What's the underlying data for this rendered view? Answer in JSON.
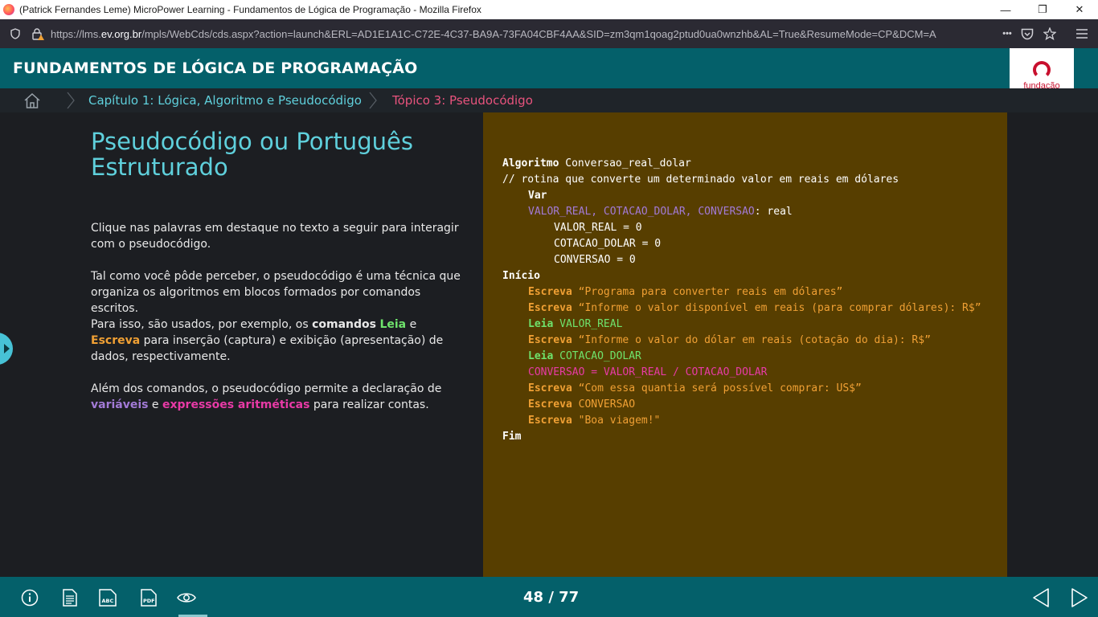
{
  "browser": {
    "window_title": "(Patrick Fernandes Leme) MicroPower Learning - Fundamentos de Lógica de Programação - Mozilla Firefox",
    "url_prefix": "https://lms.",
    "url_domain": "ev.org.br",
    "url_rest": "/mpls/WebCds/cds.aspx?action=launch&ERL=AD1E1A1C-C72E-4C37-BA9A-73FA04CBF4AA&SID=zm3qm1qoag2ptud0ua0wnzhb&AL=True&ResumeMode=CP&DCM=A",
    "more_label": "•••"
  },
  "course": {
    "title": "FUNDAMENTOS DE LÓGICA DE PROGRAMAÇÃO",
    "logo_line1": "fundação",
    "logo_line2": "bradesco"
  },
  "breadcrumb": {
    "chapter": "Capítulo 1: Lógica, Algoritmo e Pseudocódigo",
    "topic": "Tópico 3: Pseudocódigo"
  },
  "content": {
    "title": "Pseudocódigo ou Português Estruturado",
    "p1": "Clique nas palavras em destaque no texto a seguir para interagir com o pseudocódigo.",
    "p2": "Tal como você pôde perceber, o pseudocódigo é uma técnica que organiza os algoritmos em blocos formados por comandos escritos.",
    "p3_a": "Para isso, são usados, por exemplo, os ",
    "p3_comandos": "comandos",
    "p3_sp": " ",
    "p3_leia": "Leia",
    "p3_e": " e ",
    "p3_escreva": "Escreva",
    "p3_b": " para inserção (captura) e exibição (apresentação) de dados, respectivamente.",
    "p4_a": "Além dos comandos, o pseudocódigo permite a declaração de ",
    "p4_variaveis": "variáveis",
    "p4_e": " e ",
    "p4_expressoes": "expressões aritméticas",
    "p4_b": " para realizar contas."
  },
  "code": {
    "l1_kw": "Algoritmo",
    "l1_rest": " Conversao_real_dolar",
    "l2": "// rotina que converte um determinado valor em reais em dólares",
    "l3_kw": "Var",
    "l4_vars": "VALOR_REAL, COTACAO_DOLAR, CONVERSAO",
    "l4_rest": ": real",
    "l5": "VALOR_REAL = 0",
    "l6": "COTACAO_DOLAR = 0",
    "l7": "CONVERSAO = 0",
    "l8_kw": "Início",
    "l9_kw": "Escreva",
    "l9_rest": " “Programa para converter reais em dólares”",
    "l10_kw": "Escreva",
    "l10_rest": " “Informe o valor disponível em reais (para comprar dólares): R$”",
    "l11_kw": "Leia",
    "l11_rest": " VALOR_REAL",
    "l12_kw": "Escreva",
    "l12_rest": " “Informe o valor do dólar em reais (cotação do dia): R$”",
    "l13_kw": "Leia",
    "l13_rest": " COTACAO_DOLAR",
    "l14": "CONVERSAO = VALOR_REAL / COTACAO_DOLAR",
    "l15_kw": "Escreva",
    "l15_rest": " “Com essa quantia será possível comprar: US$”",
    "l16_kw": "Escreva",
    "l16_rest": " CONVERSAO",
    "l17_kw": "Escreva",
    "l17_rest": " \"Boa viagem!\"",
    "l18_kw": "Fim"
  },
  "footer": {
    "counter": "48 / 77",
    "icons": [
      "info-icon",
      "document-icon",
      "glossary-abc-icon",
      "pdf-icon",
      "eye-icon",
      "previous-icon",
      "next-icon"
    ]
  },
  "colors": {
    "header_teal": "#04606a",
    "accent_cyan": "#5fd0dc",
    "topic_pink": "#e8537d",
    "code_bg": "#573e00",
    "leia_green": "#6fe36c",
    "escreva_orange": "#f0a034",
    "variable_purple": "#a27ad6",
    "expression_magenta": "#e83aa6"
  }
}
